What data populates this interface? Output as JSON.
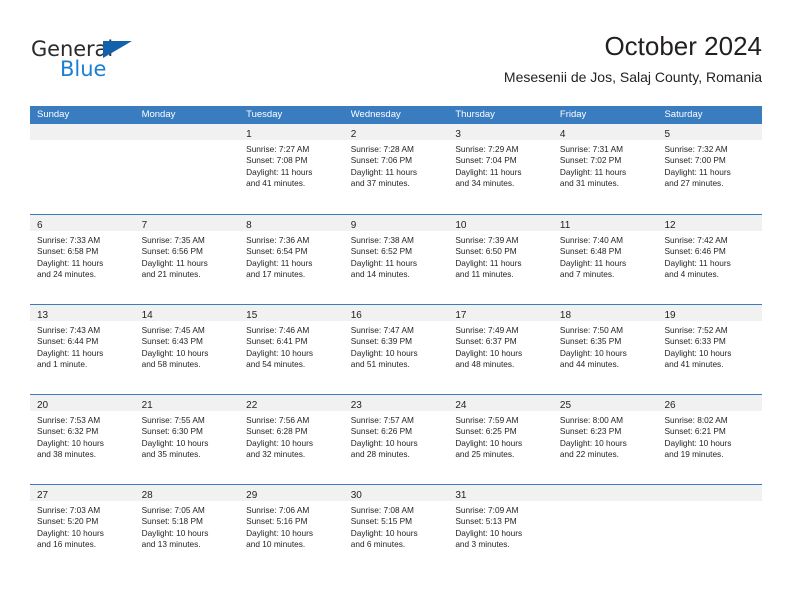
{
  "brand": {
    "name_part1": "General",
    "name_part2": "Blue",
    "triangle_color": "#1461ab",
    "blue_color": "#1b7fd4"
  },
  "header": {
    "title": "October 2024",
    "subtitle": "Mesesenii de Jos, Salaj County, Romania"
  },
  "theme": {
    "header_blue": "#3a7cc0",
    "day_band_gray": "#f1f1f1",
    "text_color": "#231f20"
  },
  "weekdays": [
    "Sunday",
    "Monday",
    "Tuesday",
    "Wednesday",
    "Thursday",
    "Friday",
    "Saturday"
  ],
  "weeks": [
    [
      {
        "day": "",
        "sunrise": "",
        "sunset": "",
        "daylight_line1": "",
        "daylight_line2": ""
      },
      {
        "day": "",
        "sunrise": "",
        "sunset": "",
        "daylight_line1": "",
        "daylight_line2": ""
      },
      {
        "day": "1",
        "sunrise": "Sunrise: 7:27 AM",
        "sunset": "Sunset: 7:08 PM",
        "daylight_line1": "Daylight: 11 hours",
        "daylight_line2": "and 41 minutes."
      },
      {
        "day": "2",
        "sunrise": "Sunrise: 7:28 AM",
        "sunset": "Sunset: 7:06 PM",
        "daylight_line1": "Daylight: 11 hours",
        "daylight_line2": "and 37 minutes."
      },
      {
        "day": "3",
        "sunrise": "Sunrise: 7:29 AM",
        "sunset": "Sunset: 7:04 PM",
        "daylight_line1": "Daylight: 11 hours",
        "daylight_line2": "and 34 minutes."
      },
      {
        "day": "4",
        "sunrise": "Sunrise: 7:31 AM",
        "sunset": "Sunset: 7:02 PM",
        "daylight_line1": "Daylight: 11 hours",
        "daylight_line2": "and 31 minutes."
      },
      {
        "day": "5",
        "sunrise": "Sunrise: 7:32 AM",
        "sunset": "Sunset: 7:00 PM",
        "daylight_line1": "Daylight: 11 hours",
        "daylight_line2": "and 27 minutes."
      }
    ],
    [
      {
        "day": "6",
        "sunrise": "Sunrise: 7:33 AM",
        "sunset": "Sunset: 6:58 PM",
        "daylight_line1": "Daylight: 11 hours",
        "daylight_line2": "and 24 minutes."
      },
      {
        "day": "7",
        "sunrise": "Sunrise: 7:35 AM",
        "sunset": "Sunset: 6:56 PM",
        "daylight_line1": "Daylight: 11 hours",
        "daylight_line2": "and 21 minutes."
      },
      {
        "day": "8",
        "sunrise": "Sunrise: 7:36 AM",
        "sunset": "Sunset: 6:54 PM",
        "daylight_line1": "Daylight: 11 hours",
        "daylight_line2": "and 17 minutes."
      },
      {
        "day": "9",
        "sunrise": "Sunrise: 7:38 AM",
        "sunset": "Sunset: 6:52 PM",
        "daylight_line1": "Daylight: 11 hours",
        "daylight_line2": "and 14 minutes."
      },
      {
        "day": "10",
        "sunrise": "Sunrise: 7:39 AM",
        "sunset": "Sunset: 6:50 PM",
        "daylight_line1": "Daylight: 11 hours",
        "daylight_line2": "and 11 minutes."
      },
      {
        "day": "11",
        "sunrise": "Sunrise: 7:40 AM",
        "sunset": "Sunset: 6:48 PM",
        "daylight_line1": "Daylight: 11 hours",
        "daylight_line2": "and 7 minutes."
      },
      {
        "day": "12",
        "sunrise": "Sunrise: 7:42 AM",
        "sunset": "Sunset: 6:46 PM",
        "daylight_line1": "Daylight: 11 hours",
        "daylight_line2": "and 4 minutes."
      }
    ],
    [
      {
        "day": "13",
        "sunrise": "Sunrise: 7:43 AM",
        "sunset": "Sunset: 6:44 PM",
        "daylight_line1": "Daylight: 11 hours",
        "daylight_line2": "and 1 minute."
      },
      {
        "day": "14",
        "sunrise": "Sunrise: 7:45 AM",
        "sunset": "Sunset: 6:43 PM",
        "daylight_line1": "Daylight: 10 hours",
        "daylight_line2": "and 58 minutes."
      },
      {
        "day": "15",
        "sunrise": "Sunrise: 7:46 AM",
        "sunset": "Sunset: 6:41 PM",
        "daylight_line1": "Daylight: 10 hours",
        "daylight_line2": "and 54 minutes."
      },
      {
        "day": "16",
        "sunrise": "Sunrise: 7:47 AM",
        "sunset": "Sunset: 6:39 PM",
        "daylight_line1": "Daylight: 10 hours",
        "daylight_line2": "and 51 minutes."
      },
      {
        "day": "17",
        "sunrise": "Sunrise: 7:49 AM",
        "sunset": "Sunset: 6:37 PM",
        "daylight_line1": "Daylight: 10 hours",
        "daylight_line2": "and 48 minutes."
      },
      {
        "day": "18",
        "sunrise": "Sunrise: 7:50 AM",
        "sunset": "Sunset: 6:35 PM",
        "daylight_line1": "Daylight: 10 hours",
        "daylight_line2": "and 44 minutes."
      },
      {
        "day": "19",
        "sunrise": "Sunrise: 7:52 AM",
        "sunset": "Sunset: 6:33 PM",
        "daylight_line1": "Daylight: 10 hours",
        "daylight_line2": "and 41 minutes."
      }
    ],
    [
      {
        "day": "20",
        "sunrise": "Sunrise: 7:53 AM",
        "sunset": "Sunset: 6:32 PM",
        "daylight_line1": "Daylight: 10 hours",
        "daylight_line2": "and 38 minutes."
      },
      {
        "day": "21",
        "sunrise": "Sunrise: 7:55 AM",
        "sunset": "Sunset: 6:30 PM",
        "daylight_line1": "Daylight: 10 hours",
        "daylight_line2": "and 35 minutes."
      },
      {
        "day": "22",
        "sunrise": "Sunrise: 7:56 AM",
        "sunset": "Sunset: 6:28 PM",
        "daylight_line1": "Daylight: 10 hours",
        "daylight_line2": "and 32 minutes."
      },
      {
        "day": "23",
        "sunrise": "Sunrise: 7:57 AM",
        "sunset": "Sunset: 6:26 PM",
        "daylight_line1": "Daylight: 10 hours",
        "daylight_line2": "and 28 minutes."
      },
      {
        "day": "24",
        "sunrise": "Sunrise: 7:59 AM",
        "sunset": "Sunset: 6:25 PM",
        "daylight_line1": "Daylight: 10 hours",
        "daylight_line2": "and 25 minutes."
      },
      {
        "day": "25",
        "sunrise": "Sunrise: 8:00 AM",
        "sunset": "Sunset: 6:23 PM",
        "daylight_line1": "Daylight: 10 hours",
        "daylight_line2": "and 22 minutes."
      },
      {
        "day": "26",
        "sunrise": "Sunrise: 8:02 AM",
        "sunset": "Sunset: 6:21 PM",
        "daylight_line1": "Daylight: 10 hours",
        "daylight_line2": "and 19 minutes."
      }
    ],
    [
      {
        "day": "27",
        "sunrise": "Sunrise: 7:03 AM",
        "sunset": "Sunset: 5:20 PM",
        "daylight_line1": "Daylight: 10 hours",
        "daylight_line2": "and 16 minutes."
      },
      {
        "day": "28",
        "sunrise": "Sunrise: 7:05 AM",
        "sunset": "Sunset: 5:18 PM",
        "daylight_line1": "Daylight: 10 hours",
        "daylight_line2": "and 13 minutes."
      },
      {
        "day": "29",
        "sunrise": "Sunrise: 7:06 AM",
        "sunset": "Sunset: 5:16 PM",
        "daylight_line1": "Daylight: 10 hours",
        "daylight_line2": "and 10 minutes."
      },
      {
        "day": "30",
        "sunrise": "Sunrise: 7:08 AM",
        "sunset": "Sunset: 5:15 PM",
        "daylight_line1": "Daylight: 10 hours",
        "daylight_line2": "and 6 minutes."
      },
      {
        "day": "31",
        "sunrise": "Sunrise: 7:09 AM",
        "sunset": "Sunset: 5:13 PM",
        "daylight_line1": "Daylight: 10 hours",
        "daylight_line2": "and 3 minutes."
      },
      {
        "day": "",
        "sunrise": "",
        "sunset": "",
        "daylight_line1": "",
        "daylight_line2": ""
      },
      {
        "day": "",
        "sunrise": "",
        "sunset": "",
        "daylight_line1": "",
        "daylight_line2": ""
      }
    ]
  ]
}
